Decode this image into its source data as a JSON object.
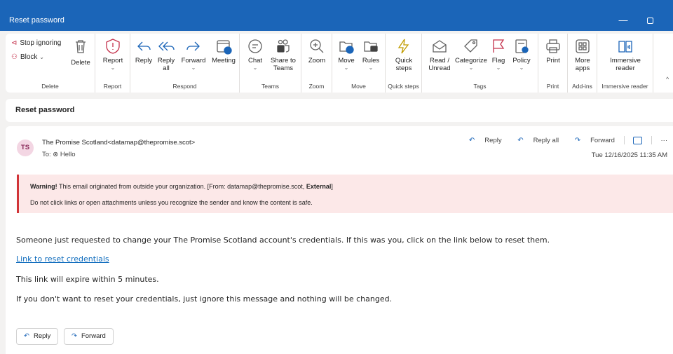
{
  "window": {
    "title": "Reset password",
    "minimize": "—"
  },
  "ribbon": {
    "delete_group": {
      "stop_ignoring": "Stop ignoring",
      "block": "Block",
      "delete": "Delete",
      "label": "Delete"
    },
    "report_group": {
      "report": "Report",
      "label": "Report"
    },
    "respond_group": {
      "reply": "Reply",
      "reply_all": "Reply all",
      "forward": "Forward",
      "meeting": "Meeting",
      "label": "Respond"
    },
    "teams_group": {
      "chat": "Chat",
      "share_to_teams": "Share to Teams",
      "label": "Teams"
    },
    "zoom_group": {
      "zoom": "Zoom",
      "label": "Zoom"
    },
    "move_group": {
      "move": "Move",
      "rules": "Rules",
      "label": "Move"
    },
    "quick_steps_group": {
      "quick_steps": "Quick steps",
      "label": "Quick steps"
    },
    "tags_group": {
      "read_unread": "Read / Unread",
      "categorize": "Categorize",
      "flag": "Flag",
      "policy": "Policy",
      "label": "Tags"
    },
    "print_group": {
      "print": "Print",
      "label": "Print"
    },
    "addins_group": {
      "more_apps": "More apps",
      "label": "Add-ins"
    },
    "immersive_group": {
      "immersive_reader": "Immersive reader",
      "label": "Immersive reader"
    }
  },
  "subject": "Reset password",
  "message": {
    "avatar_initials": "TS",
    "sender": "The Promise Scotland<datamap@thepromise.scot>",
    "to": "To: ⊗ Hello",
    "date": "Tue 12/16/2025 11:35 AM",
    "actions": {
      "reply": "Reply",
      "reply_all": "Reply all",
      "forward": "Forward",
      "more": "···"
    },
    "warning": {
      "title": "Warning!",
      "line1_text": " This email originated from outside your organization. [From: datamap@thepromise.scot, ",
      "external": "External",
      "line1_end": "]",
      "line2": "Do not click links or open attachments unless you recognize the sender and know the content is safe."
    },
    "body": {
      "p1": "Someone just requested to change your The Promise Scotland account's credentials. If this was you, click on the link below to reset them.",
      "link": "Link to reset credentials",
      "p2": "This link will expire within 5 minutes.",
      "p3": "If you don't want to reset your credentials, just ignore this message and nothing will be changed."
    },
    "footer": {
      "reply": "Reply",
      "forward": "Forward"
    }
  },
  "colors": {
    "titlebar": "#1b65b8",
    "warning_bg": "#fce8e8",
    "warning_border": "#d13438",
    "link": "#0f6cbd"
  }
}
